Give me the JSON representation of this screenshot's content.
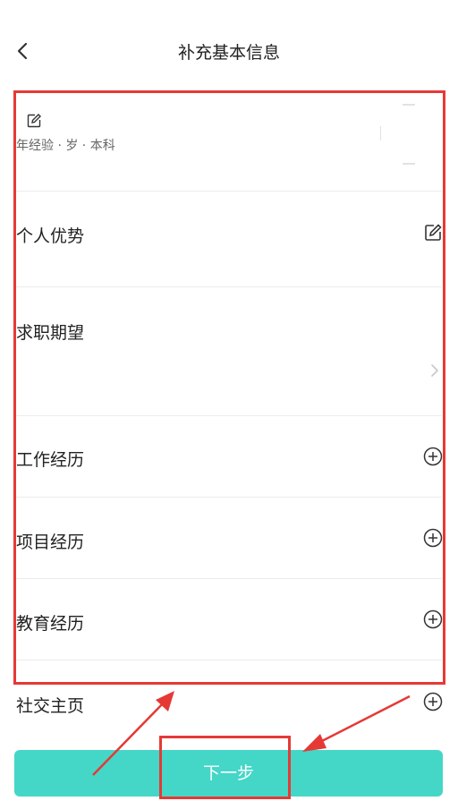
{
  "header": {
    "title": "补充基本信息"
  },
  "profile": {
    "meta": "年经验 · 岁 · 本科"
  },
  "sections": [
    {
      "title": "个人优势"
    },
    {
      "title": "求职期望"
    },
    {
      "title": "工作经历"
    },
    {
      "title": "项目经历"
    },
    {
      "title": "教育经历"
    },
    {
      "title": "社交主页"
    }
  ],
  "footer": {
    "next_label": "下一步"
  },
  "colors": {
    "accent": "#44d7c8",
    "annotation_red": "#e53935"
  },
  "icons": {
    "back": "chevron-left-icon",
    "edit": "edit-icon",
    "add": "plus-circle-icon",
    "chevron": "chevron-right-icon"
  }
}
